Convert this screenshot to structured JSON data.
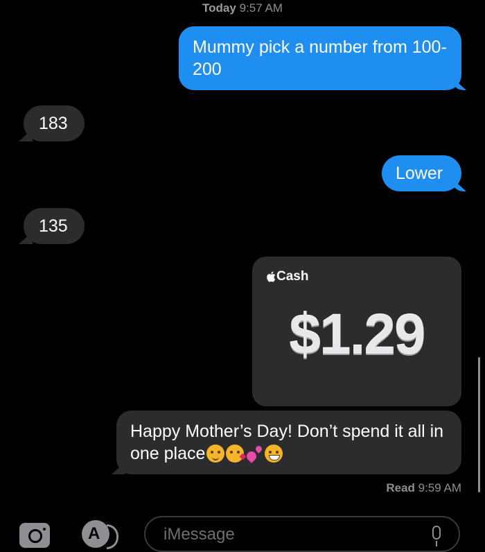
{
  "conversation": {
    "timestamp_day": "Today",
    "timestamp_time": "9:57 AM",
    "messages": [
      {
        "direction": "sent",
        "text": "Mummy pick a number from 100-200"
      },
      {
        "direction": "received",
        "text": "183"
      },
      {
        "direction": "sent",
        "text": "Lower"
      },
      {
        "direction": "received",
        "text": "135"
      },
      {
        "direction": "received",
        "text": "Happy Mother’s Day! Don’t spend it all in one place"
      }
    ],
    "cash_payment": {
      "brand": "Cash",
      "amount": "$1.29"
    },
    "emojis": [
      "smiling-face-with-hearts-icon",
      "face-blowing-kiss-icon",
      "two-hearts-icon",
      "grinning-face-icon"
    ],
    "read_receipt_label": "Read",
    "read_receipt_time": "9:59 AM"
  },
  "input_bar": {
    "placeholder": "iMessage",
    "value": ""
  },
  "colors": {
    "sent_bubble": "#1f8ef1",
    "received_bubble": "#2c2c2e",
    "background": "#000000"
  }
}
